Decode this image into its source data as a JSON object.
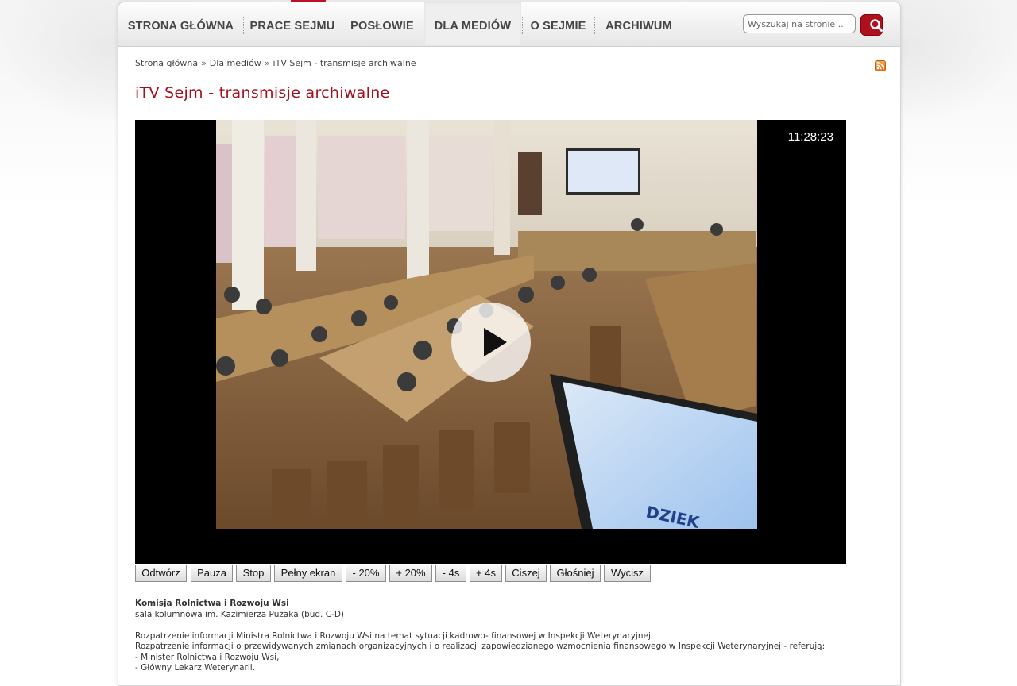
{
  "nav": {
    "items": [
      {
        "label": "STRONA GŁÓWNA",
        "active": false
      },
      {
        "label": "PRACE SEJMU",
        "active": false
      },
      {
        "label": "POSŁOWIE",
        "active": false
      },
      {
        "label": "DLA MEDIÓW",
        "active": true
      },
      {
        "label": "O SEJMIE",
        "active": false
      },
      {
        "label": "ARCHIWUM",
        "active": false
      }
    ],
    "search_placeholder": "Wyszukaj na stronie ...",
    "search_icon": "magnifier-icon"
  },
  "breadcrumb": {
    "items": [
      "Strona główna",
      "Dla mediów",
      "iTV Sejm - transmisje archiwalne"
    ],
    "separator": "»"
  },
  "page": {
    "title": "iTV Sejm - transmisje archiwalne",
    "rss_icon": "rss-icon"
  },
  "player": {
    "time": "11:28:23",
    "screen_text": "DZIEK",
    "controls": [
      "Odtwórz",
      "Pauza",
      "Stop",
      "Pełny ekran",
      "- 20%",
      "+ 20%",
      "- 4s",
      "+ 4s",
      "Ciszej",
      "Głośniej",
      "Wycisz"
    ]
  },
  "info": {
    "committee": "Komisja Rolnictwa i Rozwoju Wsi",
    "room": "sala kolumnowa im. Kazimierza Pużaka (bud. C-D)",
    "agenda": [
      "Rozpatrzenie informacji Ministra Rolnictwa i Rozwoju Wsi na temat sytuacji kadrowo- finansowej w Inspekcji Weterynaryjnej.",
      "Rozpatrzenie informacji o przewidywanych zmianach organizacyjnych i o realizacji zapowiedzianego wzmocnienia finansowego w Inspekcji Weterynaryjnej - referują:",
      "- Minister Rolnictwa i Rozwoju Wsi,",
      "- Główny Lekarz Weterynarii."
    ]
  },
  "colors": {
    "accent": "#a3101b",
    "search_button": "#b0101e"
  }
}
